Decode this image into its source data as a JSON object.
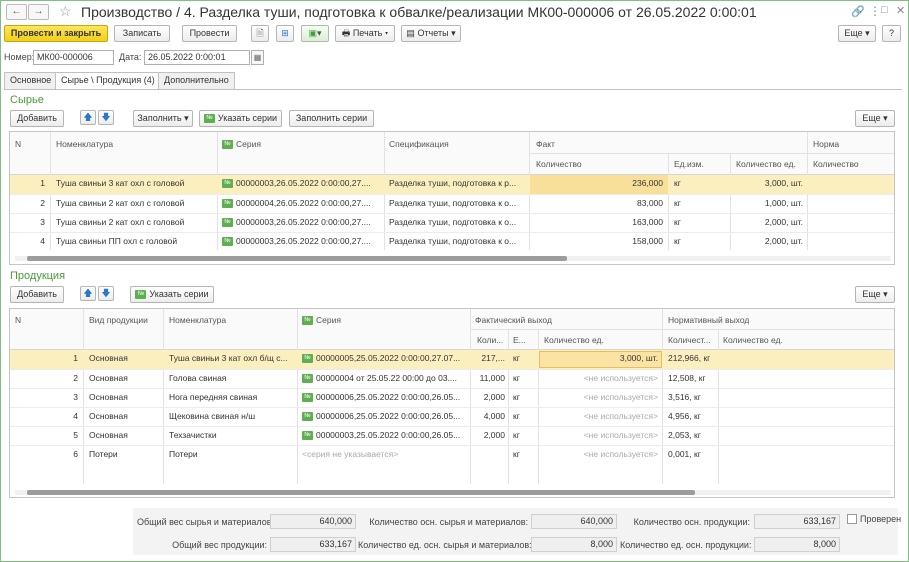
{
  "window": {
    "title": "Производство / 4. Разделка туши, подготовка к обвалке/реализации МК00-000006 от 26.05.2022 0:00:01",
    "back": "←",
    "forward": "→",
    "star": "☆",
    "link": "🔗",
    "more": "⋮",
    "max": "□",
    "close": "✕"
  },
  "toolbar": {
    "post_close": "Провести и закрыть",
    "save": "Записать",
    "post": "Провести",
    "print": "Печать",
    "reports": "Отчеты",
    "more": "Еще",
    "help": "?"
  },
  "header": {
    "number_label": "Номер:",
    "number_value": "МК00-000006",
    "date_label": "Дата:",
    "date_value": "26.05.2022  0:00:01"
  },
  "tabs": [
    {
      "label": "Основное"
    },
    {
      "label": "Сырье \\ Продукция (4)"
    },
    {
      "label": "Дополнительно"
    }
  ],
  "raw": {
    "title": "Сырье",
    "add": "Добавить",
    "fill": "Заполнить",
    "set_series": "Указать серии",
    "fill_series": "Заполнить серии",
    "more": "Еще",
    "headers": {
      "n": "N",
      "nomenclature": "Номенклатура",
      "series": "Серия",
      "spec": "Спецификация",
      "fact": "Факт",
      "qty": "Количество",
      "unit": "Ед.изм.",
      "qty_units": "Количество ед.",
      "norm": "Норма",
      "norm_qty": "Количество"
    },
    "rows": [
      {
        "n": "1",
        "nom": "Туша свиньи 3 кат охл с головой",
        "series": "00000003,26.05.2022 0:00:00,27....",
        "spec": "Разделка туши, подготовка к р...",
        "qty": "236,000",
        "unit": "кг",
        "qty_units": "3,000, шт."
      },
      {
        "n": "2",
        "nom": "Туша свиньи 2 кат охл с головой",
        "series": "00000004,26.05.2022 0:00:00,27....",
        "spec": "Разделка туши, подготовка к о...",
        "qty": "83,000",
        "unit": "кг",
        "qty_units": "1,000, шт."
      },
      {
        "n": "3",
        "nom": "Туша свиньи 2 кат охл с головой",
        "series": "00000003,26.05.2022 0:00:00,27....",
        "spec": "Разделка туши, подготовка к о...",
        "qty": "163,000",
        "unit": "кг",
        "qty_units": "2,000, шт."
      },
      {
        "n": "4",
        "nom": "Туша свиньи ПП охл с головой",
        "series": "00000003,26.05.2022 0:00:00,27....",
        "spec": "Разделка туши, подготовка к о...",
        "qty": "158,000",
        "unit": "кг",
        "qty_units": "2,000, шт."
      }
    ]
  },
  "products": {
    "title": "Продукция",
    "add": "Добавить",
    "set_series": "Указать серии",
    "more": "Еще",
    "headers": {
      "n": "N",
      "kind": "Вид продукции",
      "nomenclature": "Номенклатура",
      "series": "Серия",
      "fact_out": "Фактический выход",
      "qty": "Коли...",
      "unit": "Е...",
      "qty_units": "Количество ед.",
      "norm_out": "Нормативный выход",
      "norm_qty": "Количест...",
      "norm_qty_units": "Количество ед."
    },
    "rows": [
      {
        "n": "1",
        "kind": "Основная",
        "nom": "Туша свиньи 3 кат охл б/щ с...",
        "series": "00000005,25.05.2022 0:00:00,27.07...",
        "qty": "217,...",
        "unit": "кг",
        "qty_units": "3,000, шт.",
        "norm_qty": "212,966, кг"
      },
      {
        "n": "2",
        "kind": "Основная",
        "nom": "Голова свиная",
        "series": "00000004 от 25.05.22 00:00 до 03....",
        "qty": "11,000",
        "unit": "кг",
        "qty_units": "<не используется>",
        "norm_qty": "12,508, кг"
      },
      {
        "n": "3",
        "kind": "Основная",
        "nom": "Нога передняя свиная",
        "series": "00000006,25.05.2022 0:00:00,26.05...",
        "qty": "2,000",
        "unit": "кг",
        "qty_units": "<не используется>",
        "norm_qty": "3,516, кг"
      },
      {
        "n": "4",
        "kind": "Основная",
        "nom": "Щековина свиная н/ш",
        "series": "00000006,25.05.2022 0:00:00,26.05...",
        "qty": "4,000",
        "unit": "кг",
        "qty_units": "<не используется>",
        "norm_qty": "4,956, кг"
      },
      {
        "n": "5",
        "kind": "Основная",
        "nom": "Техзачистки",
        "series": "00000003,25.05.2022 0:00:00,26.05...",
        "qty": "2,000",
        "unit": "кг",
        "qty_units": "<не используется>",
        "norm_qty": "2,053, кг"
      },
      {
        "n": "6",
        "kind": "Потери",
        "nom": "Потери",
        "series": "<серия не указывается>",
        "qty": "",
        "unit": "кг",
        "qty_units": "<не используется>",
        "norm_qty": "0,001, кг"
      }
    ]
  },
  "footer": {
    "total_raw_label": "Общий вес сырья и материалов:",
    "total_raw": "640,000",
    "qty_raw_label": "Количество осн. сырья и материалов:",
    "qty_raw": "640,000",
    "qty_prod_label": "Количество осн. продукции:",
    "qty_prod": "633,167",
    "checked_label": "Проверен",
    "total_prod_label": "Общий вес продукции:",
    "total_prod": "633,167",
    "qty_units_raw_label": "Количество ед. осн. сырья и материалов:",
    "qty_units_raw": "8,000",
    "qty_units_prod_label": "Количество ед. осн. продукции:",
    "qty_units_prod": "8,000"
  },
  "icons": {
    "series_badge": "№",
    "dropdown": "▾",
    "up": "🡅",
    "down": "🡇",
    "printer": "🖶",
    "report": "▤",
    "doc": "🗎",
    "struct": "⊞"
  },
  "colors": {
    "accent_green": "#4a9a3a",
    "primary_yellow": "#f2cf1a",
    "selected_row": "#fcefbf"
  }
}
